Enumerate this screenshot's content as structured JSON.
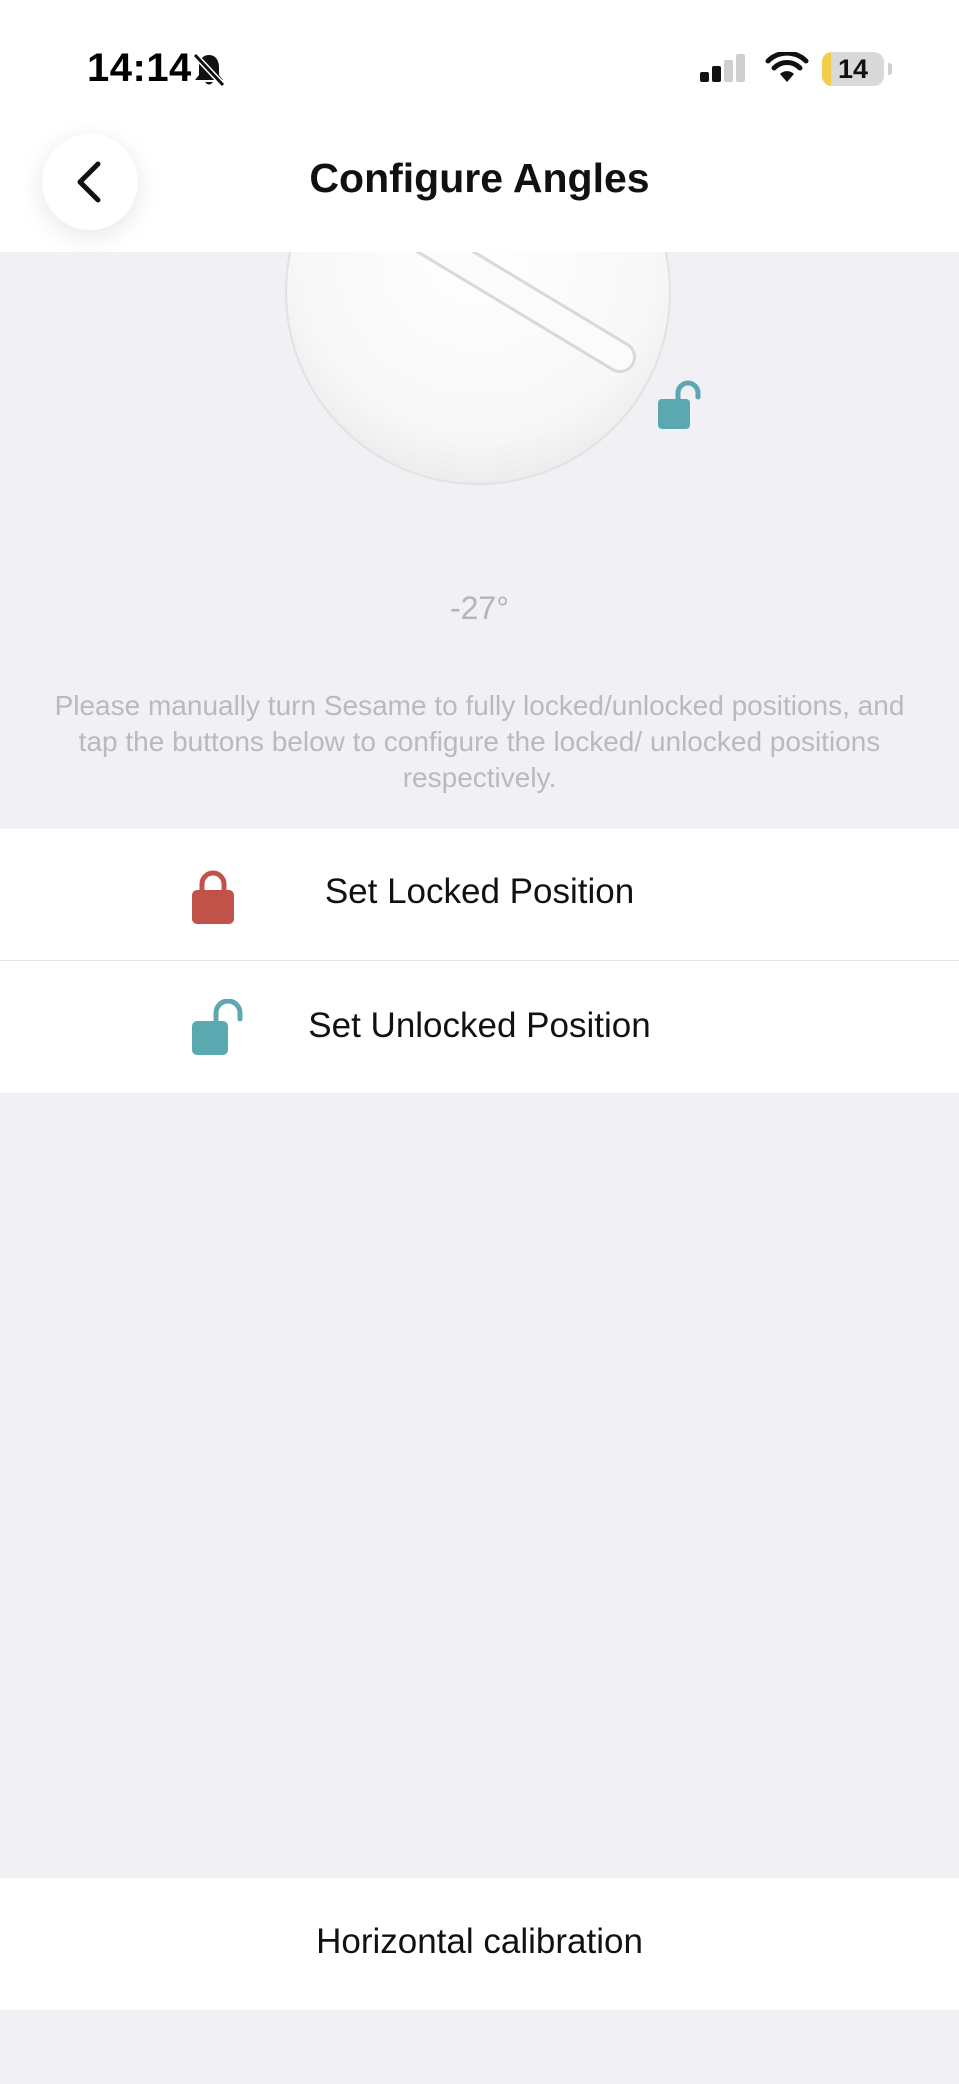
{
  "status_bar": {
    "time": "14:14",
    "battery_level": "14",
    "battery_fraction": 0.14,
    "icons": [
      "bell-slash-icon",
      "cellular-signal-icon",
      "wifi-icon",
      "battery-icon"
    ]
  },
  "header": {
    "title": "Configure Angles",
    "back_icon": "chevron-left-icon"
  },
  "dial": {
    "angle": "-27°",
    "indicator_icon": "unlocked-padlock-icon"
  },
  "instructions": "Please manually turn Sesame to fully locked/unlocked positions, and tap the buttons below to configure the locked/ unlocked positions respectively.",
  "actions": [
    {
      "label": "Set Locked Position",
      "icon": "locked-padlock-icon"
    },
    {
      "label": "Set Unlocked Position",
      "icon": "unlocked-padlock-icon"
    }
  ],
  "calibration": {
    "label": "Horizontal calibration"
  },
  "colors": {
    "background": "#f0f0f5",
    "locked": "#c0524a",
    "unlocked": "#5aa9b0",
    "text_primary": "#111111",
    "text_muted": "#b9b9be"
  }
}
